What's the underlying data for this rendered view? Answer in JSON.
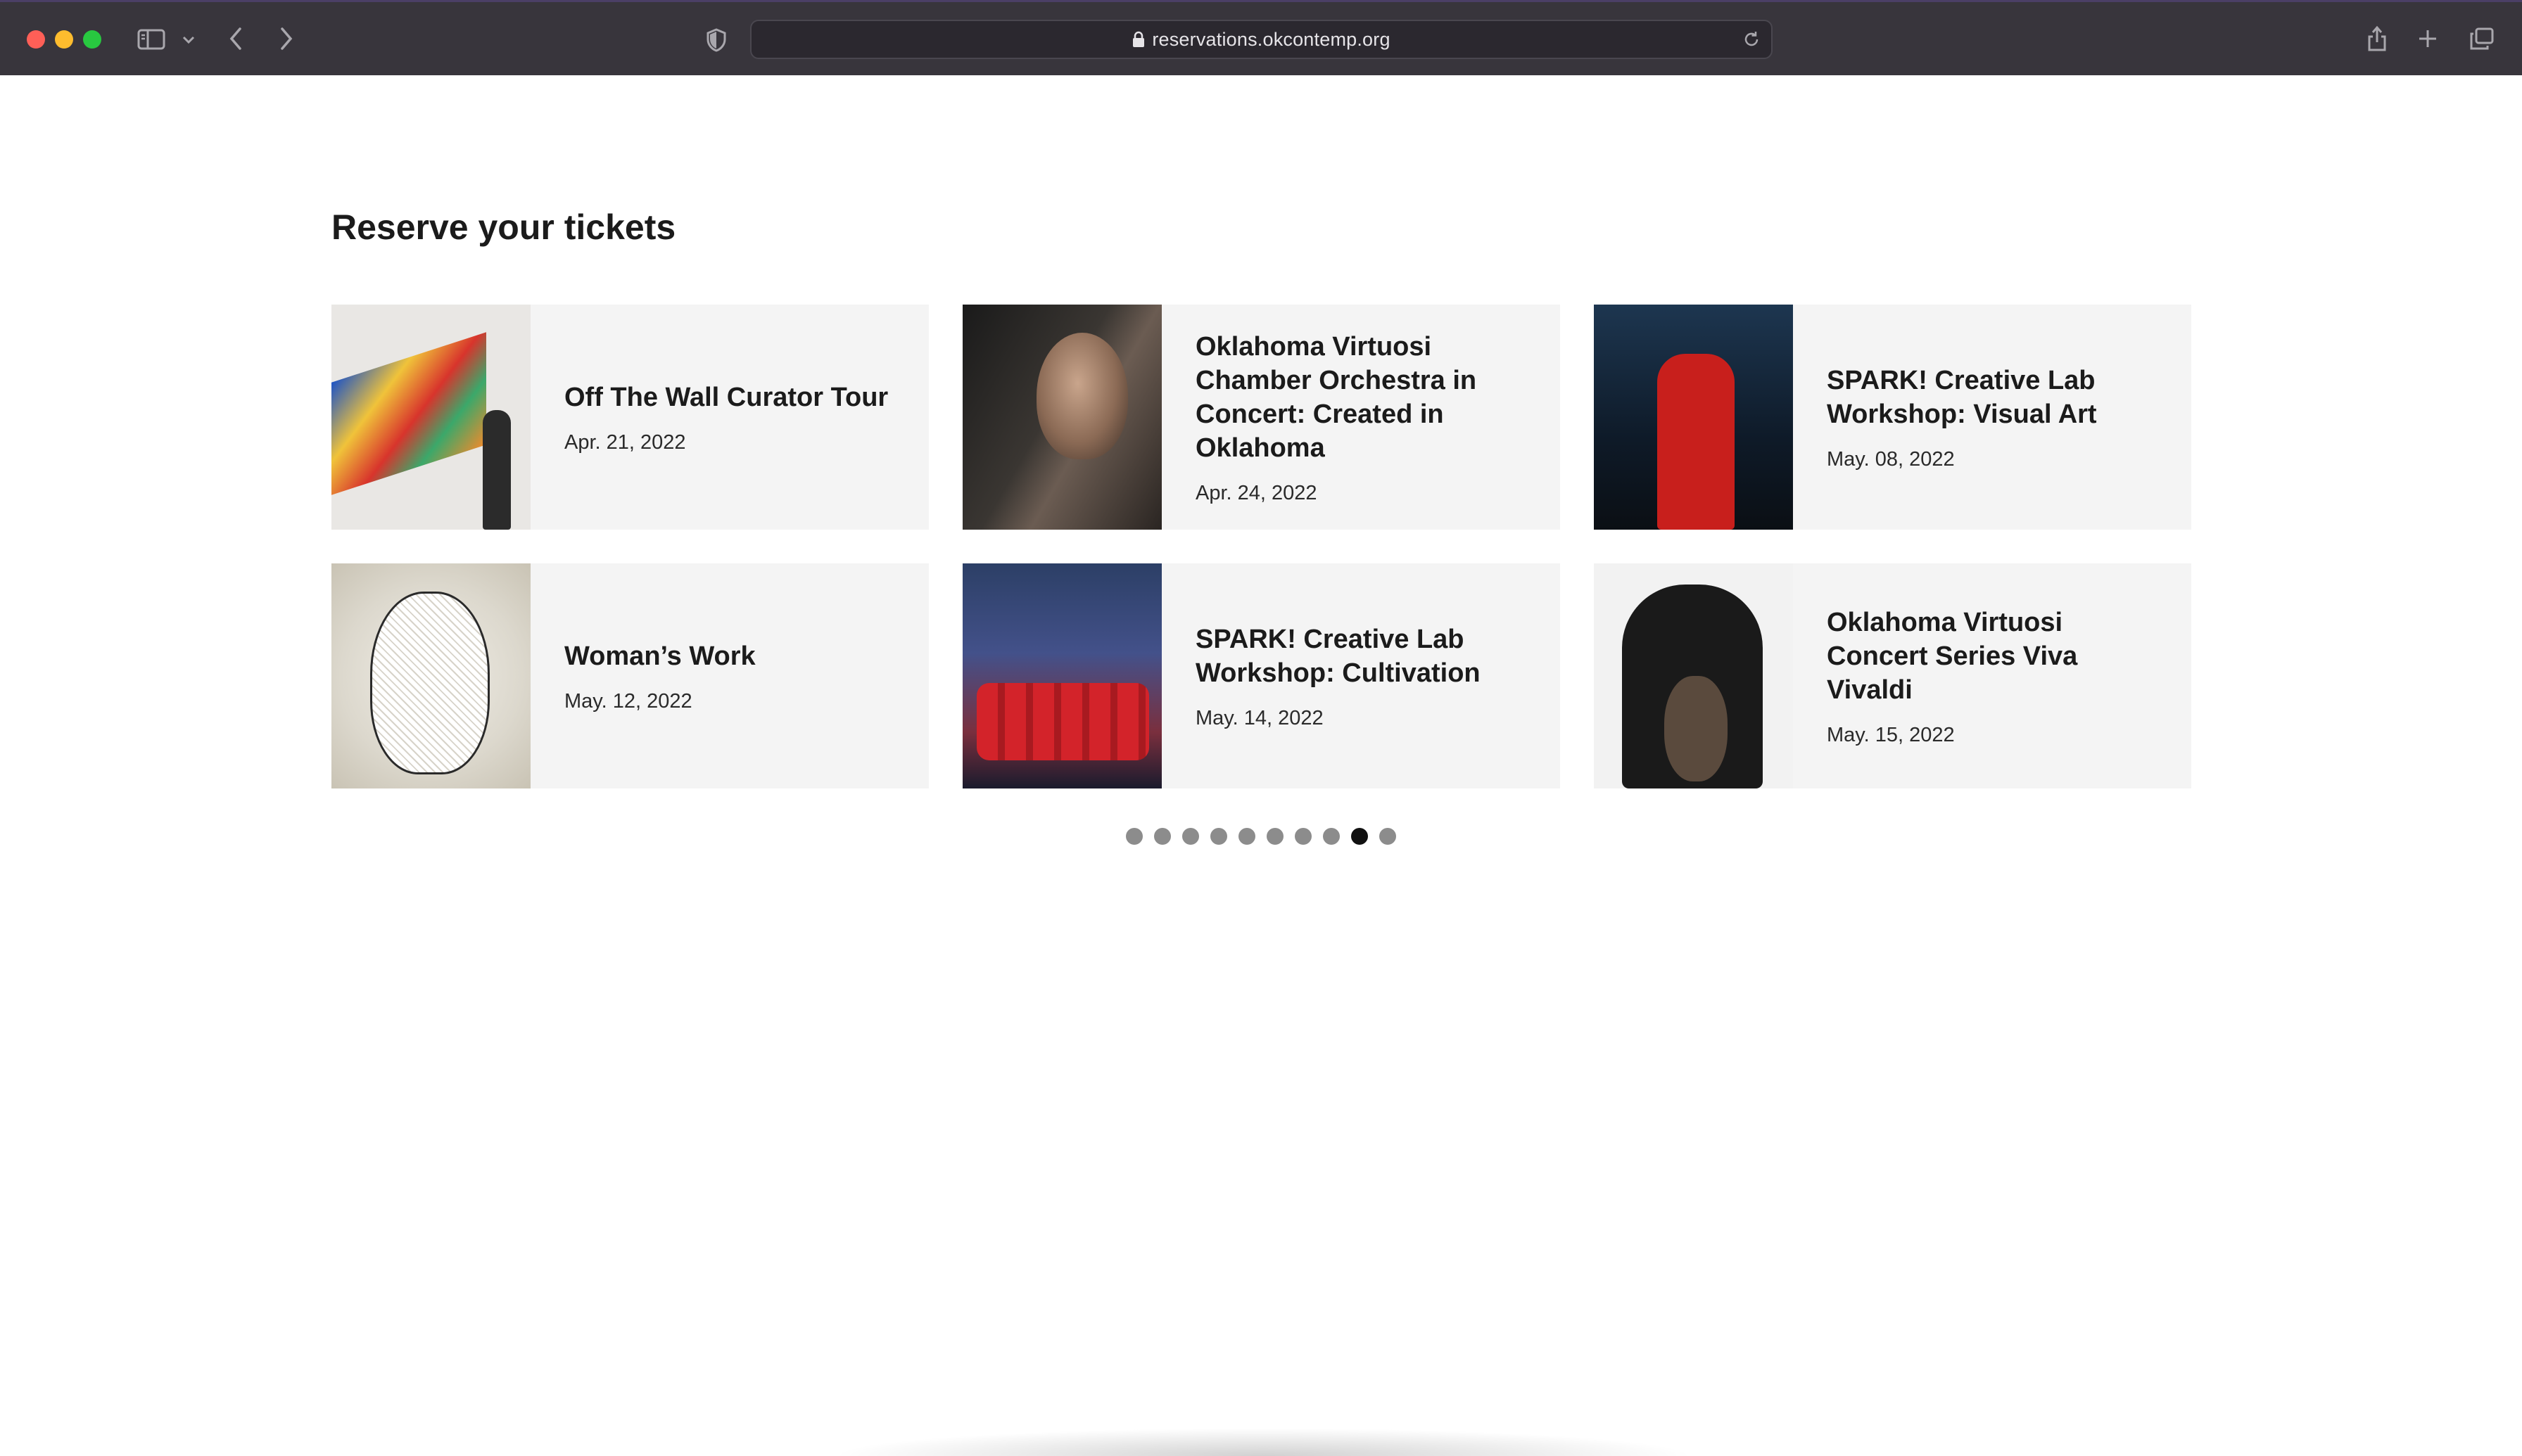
{
  "browser": {
    "url": "reservations.okcontemp.org",
    "icons": {
      "close": "close-window",
      "minimize": "minimize-window",
      "zoom": "zoom-window",
      "sidebar": "sidebar-icon",
      "sidebar_menu": "chevron-down-icon",
      "back": "back-icon",
      "forward": "forward-icon",
      "privacy": "shield-icon",
      "lock": "lock-icon",
      "reload": "reload-icon",
      "share": "share-icon",
      "new_tab": "plus-icon",
      "tab_overview": "tabs-icon"
    }
  },
  "page": {
    "title": "Reserve your tickets"
  },
  "events": [
    {
      "title": "Off The Wall Curator Tour",
      "date": "Apr. 21, 2022"
    },
    {
      "title": "Oklahoma Virtuosi Chamber Orchestra in Concert: Created in Oklahoma",
      "date": "Apr. 24, 2022"
    },
    {
      "title": "SPARK! Creative Lab Workshop: Visual Art",
      "date": "May. 08, 2022"
    },
    {
      "title": "Woman’s Work",
      "date": "May. 12, 2022"
    },
    {
      "title": "SPARK! Creative Lab Workshop: Cultivation",
      "date": "May. 14, 2022"
    },
    {
      "title": "Oklahoma Virtuosi Concert Series Viva Vivaldi",
      "date": "May. 15, 2022"
    }
  ],
  "carousel": {
    "page_count": 10,
    "active_page": 9
  },
  "colors": {
    "chrome_bg": "#38353c",
    "card_bg": "#f4f4f4",
    "dot_inactive": "#8c8c8c",
    "dot_active": "#111111"
  }
}
